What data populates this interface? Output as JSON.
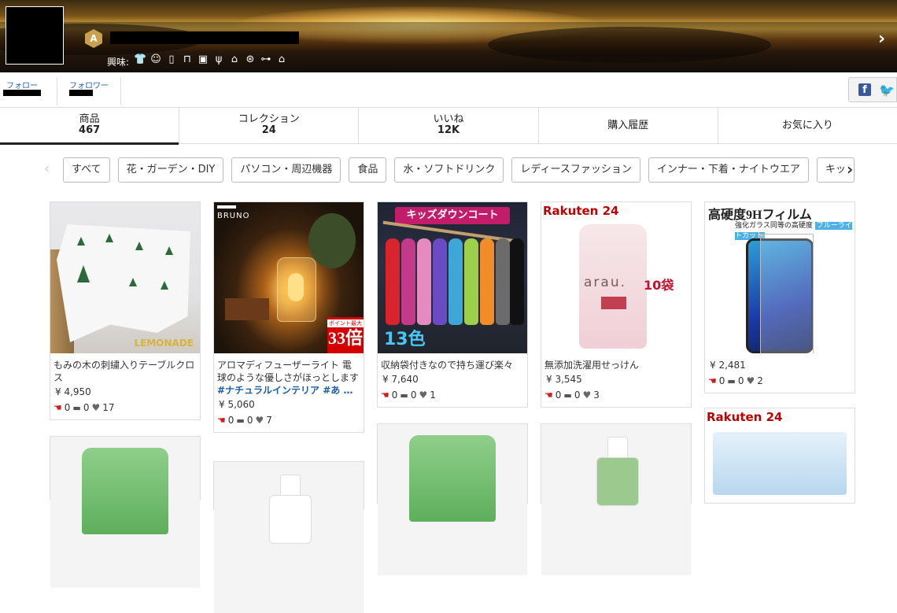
{
  "header": {
    "rank_badge": "A",
    "interest_label": "興味:",
    "interest_icons": [
      "shirt-icon",
      "bear-icon",
      "bottle-icon",
      "desk-icon",
      "appliance-icon",
      "utensils-icon",
      "shoe-icon",
      "ball-icon",
      "gamepad-icon",
      "house-icon"
    ]
  },
  "follow": {
    "following_label": "フォロー",
    "followers_label": "フォロワー"
  },
  "tabs": [
    {
      "label": "商品",
      "count": "467"
    },
    {
      "label": "コレクション",
      "count": "24"
    },
    {
      "label": "いいね",
      "count": "12K"
    },
    {
      "label": "購入履歴"
    },
    {
      "label": "お気に入り"
    }
  ],
  "categories": [
    "すべて",
    "花・ガーデン・DIY",
    "パソコン・周辺機器",
    "食品",
    "水・ソフトドリンク",
    "レディースファッション",
    "インナー・下着・ナイトウエア",
    "キッ"
  ],
  "products": [
    {
      "title": "もみの木の刺繍入りテーブルクロス",
      "price": "¥ 4,950",
      "stats": {
        "likes": "0",
        "comments": "0",
        "hearts": "17"
      }
    },
    {
      "title": "アロマディフューザーライト 電球のような優しさがほっとします",
      "hashtags": "#ナチュラルインテリア #あ …",
      "price": "¥ 5,060",
      "stats": {
        "likes": "0",
        "comments": "0",
        "hearts": "7"
      }
    },
    {
      "title": "収納袋付きなので持ち運び楽々",
      "price": "¥ 7,640",
      "stats": {
        "likes": "0",
        "comments": "0",
        "hearts": "1"
      }
    },
    {
      "title": "無添加洗濯用せっけん",
      "price": "¥ 3,545",
      "stats": {
        "likes": "0",
        "comments": "0",
        "hearts": "3"
      }
    },
    {
      "price": "¥ 2,481",
      "stats": {
        "likes": "0",
        "comments": "0",
        "hearts": "2"
      }
    }
  ],
  "image_text": {
    "lemonade": "LEMONADE",
    "bruno": "BRUNO",
    "point_small": "ポイント最大",
    "point_big": "33倍",
    "kids_header": "キッズダウンコート",
    "kids_badge": "13色",
    "rakuten": "Rakuten 24",
    "arau_logo": "arau.",
    "ten_bags": "10袋",
    "film_title": "高硬度9Hフィルム",
    "film_sub": "強化ガラス同等の高硬度",
    "film_tag": "ブルーライトカット"
  },
  "colors": {
    "link_blue": "#1d5ea8",
    "like_red": "#c81e1e",
    "rakuten_red": "#bf0000",
    "facebook": "#3b5998",
    "twitter": "#1da1f2"
  }
}
